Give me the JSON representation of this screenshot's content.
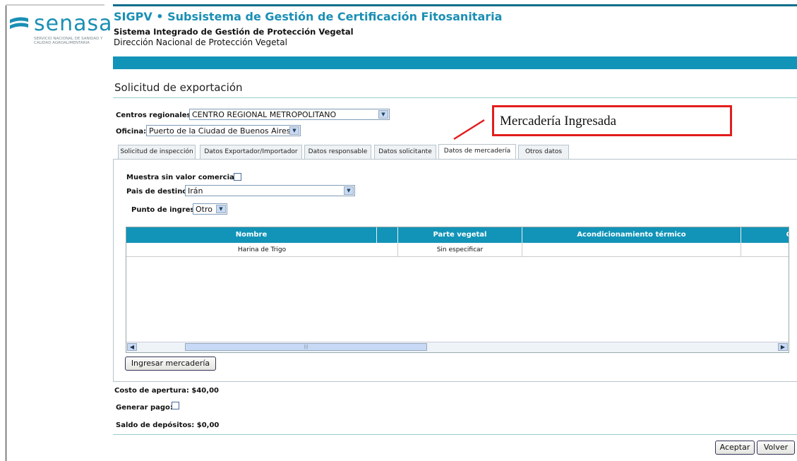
{
  "logo": {
    "name": "senasa",
    "subtitle": "SERVICIO NACIONAL DE SANIDAD Y CALIDAD AGROALIMENTARIA"
  },
  "header": {
    "title": "SIGPV • Subsistema de Gestión de Certificación Fitosanitaria",
    "system": "Sistema Integrado de Gestión de Protección Vegetal",
    "direction": "Dirección Nacional de Protección Vegetal"
  },
  "page": {
    "title": "Solicitud de exportación"
  },
  "form": {
    "centros_label": "Centros regionales:",
    "centros_value": "CENTRO REGIONAL METROPOLITANO",
    "oficina_label": "Oficina:",
    "oficina_value": "Puerto de la Ciudad de Buenos Aires"
  },
  "annotation": {
    "text": "Mercadería Ingresada",
    "color": "#e21d1d"
  },
  "tabs": [
    {
      "label": "Solicitud de inspección"
    },
    {
      "label": "Datos Exportador/Importador"
    },
    {
      "label": "Datos responsable"
    },
    {
      "label": "Datos solicitante"
    },
    {
      "label": "Datos de mercadería"
    },
    {
      "label": "Otros datos"
    }
  ],
  "active_tab": "Datos de mercadería",
  "mercaderia": {
    "muestra_label": "Muestra sin valor comercial:",
    "muestra_checked": false,
    "pais_label": "Pais de destino:",
    "pais_value": "Irán",
    "punto_label": "Punto de ingreso:",
    "punto_value": "Otro",
    "grid": {
      "columns": [
        "Nombre",
        "",
        "Parte vegetal",
        "Acondicionamiento térmico",
        "C"
      ],
      "rows": [
        [
          "Harina de Trigo",
          "",
          "Sin especificar",
          "",
          ""
        ]
      ]
    },
    "ingresar_button": "Ingresar mercadería"
  },
  "footer": {
    "costo_label": "Costo de apertura: $40,00",
    "generar_label": "Generar pago:",
    "generar_checked": false,
    "saldo_label": "Saldo de depósitos: $0,00",
    "aceptar_button": "Aceptar",
    "volver_button": "Volver"
  },
  "colors": {
    "accent": "#1294b8",
    "title": "#1a8fb5"
  }
}
